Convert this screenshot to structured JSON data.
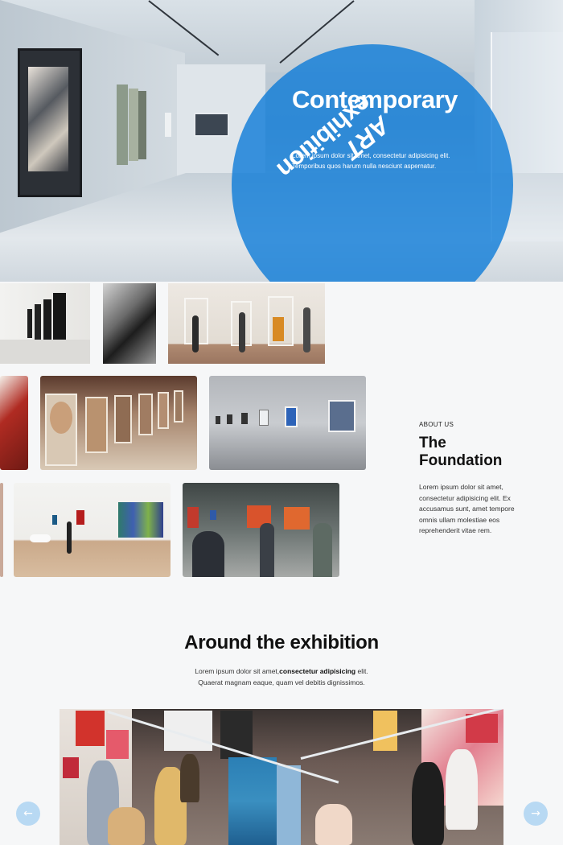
{
  "hero": {
    "title_line1": "Contemporary",
    "title_em": "ART",
    "title_rest": " exhibition",
    "subtitle_line1": "Lorem ipsum dolor sit amet, consectetur adipisicing elit.",
    "subtitle_line2": "Temporibus quos harum nulla nesciunt aspernatur.",
    "accent_color": "#0878d7"
  },
  "gallery": {
    "images": [
      "gallery-hall-frames",
      "abstract-black-white",
      "visitors-tilted-frames",
      "red-artwork",
      "easel-portraits",
      "white-wall-photos",
      "wooden-floor-hall-painting",
      "green-wall-visitors"
    ]
  },
  "about": {
    "eyebrow": "ABOUT US",
    "title_line1": "The",
    "title_line2": "Foundation",
    "text": "Lorem ipsum dolor sit amet, consectetur adipisicing elit. Ex accusamus sunt, amet tempore omnis ullam molestiae eos reprehenderit vitae rem."
  },
  "section": {
    "title": "Around the exhibition",
    "text_plain": "Lorem ipsum dolor sit amet,",
    "text_bold": "consectetur adipisicing",
    "text_plain2": " elit.",
    "text_line2": "Quaerat magnam eaque, quam vel debitis dignissimos."
  },
  "carousel": {
    "prev_icon": "←",
    "next_icon": "→",
    "button_color": "#b8d9f3"
  }
}
